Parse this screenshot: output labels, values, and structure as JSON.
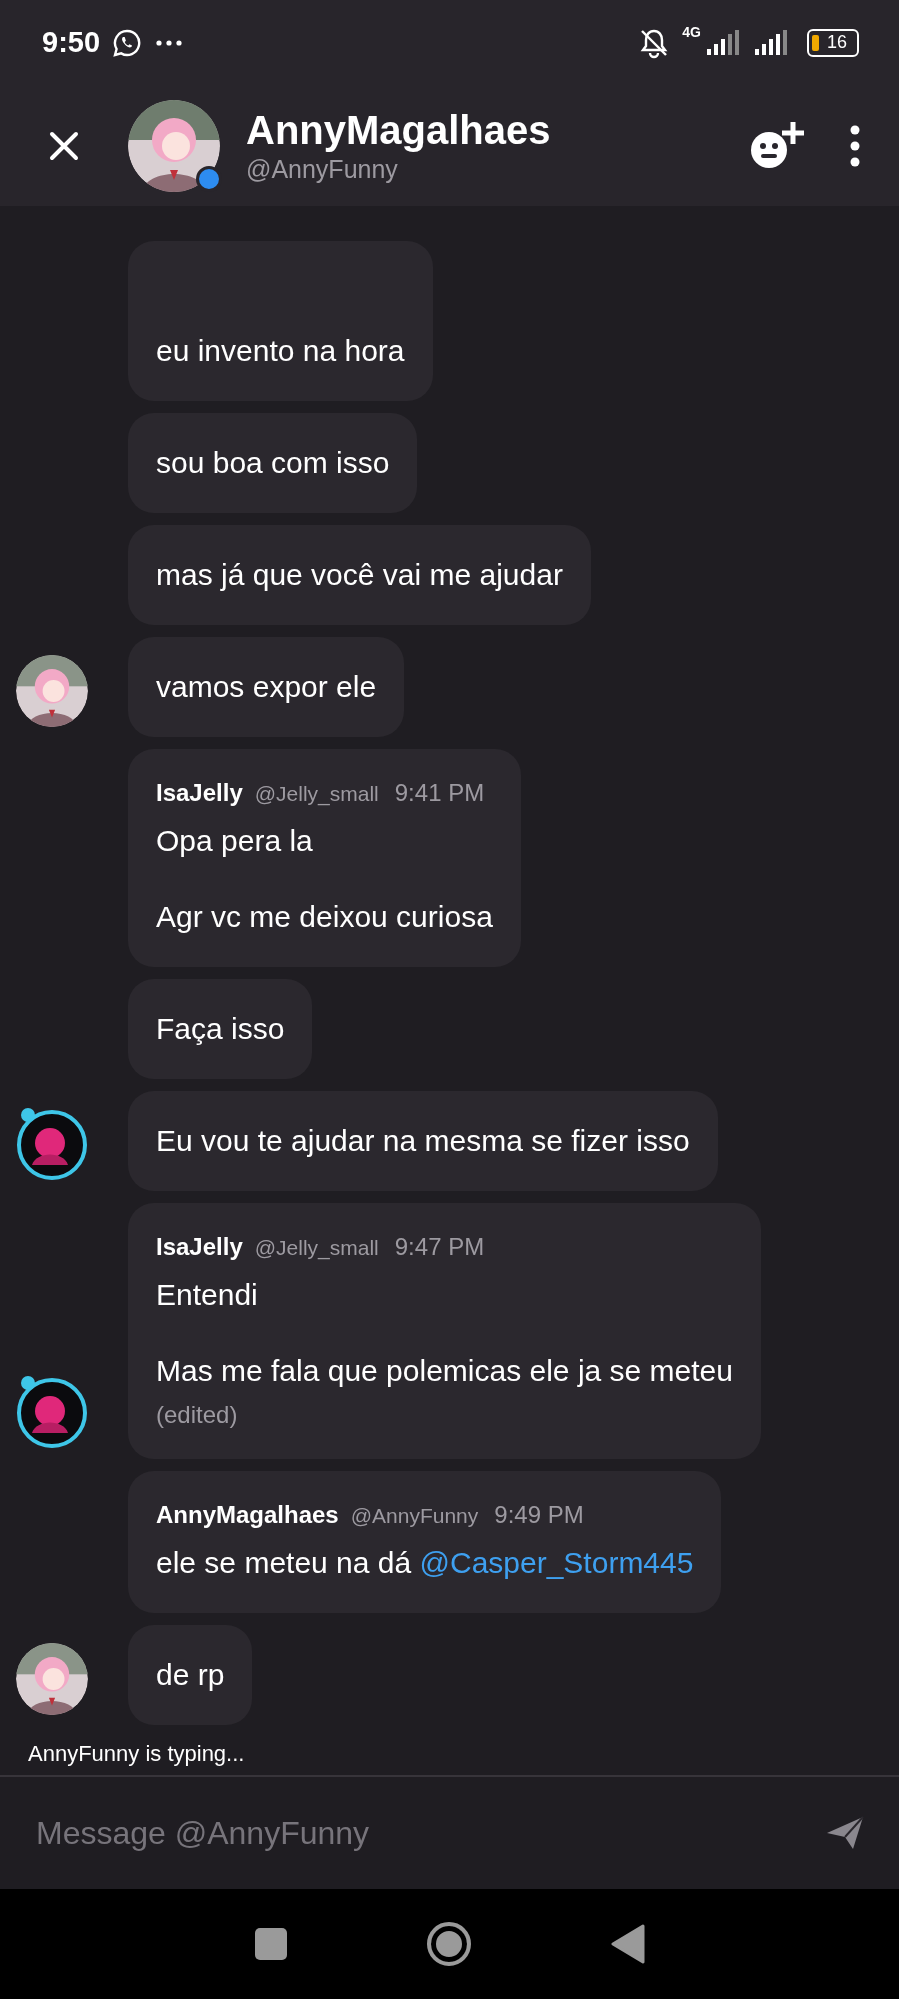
{
  "status_bar": {
    "time": "9:50",
    "network": "4G",
    "battery": "16"
  },
  "header": {
    "name": "AnnyMagalhaes",
    "handle": "@AnnyFunny",
    "online": true
  },
  "messages": [
    {
      "lines": [
        "eu invento na hora"
      ]
    },
    {
      "lines": [
        "sou boa com isso"
      ]
    },
    {
      "lines": [
        "mas já que você vai me ajudar"
      ]
    },
    {
      "lines": [
        "vamos expor ele"
      ],
      "avatar": {
        "kind": "pink"
      }
    },
    {
      "author": "IsaJelly",
      "handle": "@Jelly_small",
      "time": "9:41 PM",
      "lines": [
        "Opa pera la",
        "Agr vc me deixou curiosa"
      ]
    },
    {
      "lines": [
        "Faça isso"
      ]
    },
    {
      "lines": [
        "Eu vou te ajudar na mesma se fizer isso"
      ],
      "avatar": {
        "kind": "dark"
      }
    },
    {
      "author": "IsaJelly",
      "handle": "@Jelly_small",
      "time": "9:47 PM",
      "lines": [
        "Entendi",
        "Mas me fala que polemicas ele ja se meteu"
      ],
      "edited": "(edited)",
      "avatar": {
        "kind": "dark"
      }
    },
    {
      "author": "AnnyMagalhaes",
      "handle": "@AnnyFunny",
      "time": "9:49 PM",
      "lines": [
        "ele se meteu na dá "
      ],
      "mention": "@Casper_Storm445"
    },
    {
      "lines": [
        "de rp"
      ],
      "avatar": {
        "kind": "pink"
      }
    }
  ],
  "typing": "AnnyFunny is typing...",
  "composer": {
    "placeholder": "Message @AnnyFunny"
  }
}
